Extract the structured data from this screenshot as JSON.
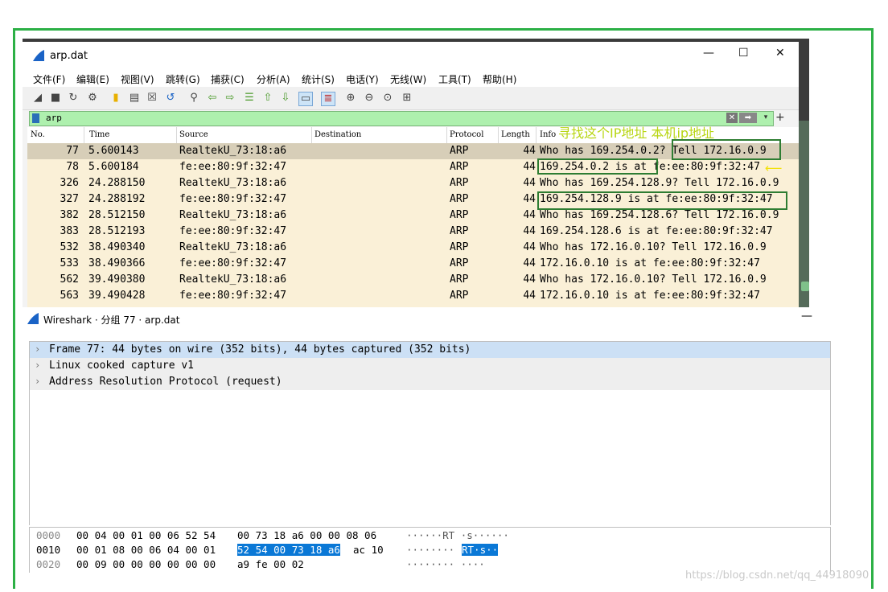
{
  "window1": {
    "title": "arp.dat",
    "controls": {
      "minimize": "—",
      "maximize": "☐",
      "close": "✕"
    },
    "menu": [
      "文件(F)",
      "编辑(E)",
      "视图(V)",
      "跳转(G)",
      "捕获(C)",
      "分析(A)",
      "统计(S)",
      "电话(Y)",
      "无线(W)",
      "工具(T)",
      "帮助(H)"
    ],
    "filter": {
      "value": "arp"
    },
    "columns": [
      "No.",
      "Time",
      "Source",
      "Destination",
      "Protocol",
      "Length",
      "Info"
    ],
    "packets": [
      {
        "no": "77",
        "time": "5.600143",
        "source": "RealtekU_73:18:a6",
        "destination": "",
        "protocol": "ARP",
        "length": "44",
        "info": "Who has 169.254.0.2? Tell 172.16.0.9"
      },
      {
        "no": "78",
        "time": "5.600184",
        "source": "fe:ee:80:9f:32:47",
        "destination": "",
        "protocol": "ARP",
        "length": "44",
        "info": "169.254.0.2 is at fe:ee:80:9f:32:47"
      },
      {
        "no": "326",
        "time": "24.288150",
        "source": "RealtekU_73:18:a6",
        "destination": "",
        "protocol": "ARP",
        "length": "44",
        "info": "Who has 169.254.128.9? Tell 172.16.0.9"
      },
      {
        "no": "327",
        "time": "24.288192",
        "source": "fe:ee:80:9f:32:47",
        "destination": "",
        "protocol": "ARP",
        "length": "44",
        "info": "169.254.128.9 is at fe:ee:80:9f:32:47"
      },
      {
        "no": "382",
        "time": "28.512150",
        "source": "RealtekU_73:18:a6",
        "destination": "",
        "protocol": "ARP",
        "length": "44",
        "info": "Who has 169.254.128.6? Tell 172.16.0.9"
      },
      {
        "no": "383",
        "time": "28.512193",
        "source": "fe:ee:80:9f:32:47",
        "destination": "",
        "protocol": "ARP",
        "length": "44",
        "info": "169.254.128.6 is at fe:ee:80:9f:32:47"
      },
      {
        "no": "532",
        "time": "38.490340",
        "source": "RealtekU_73:18:a6",
        "destination": "",
        "protocol": "ARP",
        "length": "44",
        "info": "Who has 172.16.0.10? Tell 172.16.0.9"
      },
      {
        "no": "533",
        "time": "38.490366",
        "source": "fe:ee:80:9f:32:47",
        "destination": "",
        "protocol": "ARP",
        "length": "44",
        "info": "172.16.0.10 is at fe:ee:80:9f:32:47"
      },
      {
        "no": "562",
        "time": "39.490380",
        "source": "RealtekU_73:18:a6",
        "destination": "",
        "protocol": "ARP",
        "length": "44",
        "info": "Who has 172.16.0.10? Tell 172.16.0.9"
      },
      {
        "no": "563",
        "time": "39.490428",
        "source": "fe:ee:80:9f:32:47",
        "destination": "",
        "protocol": "ARP",
        "length": "44",
        "info": "172.16.0.10 is at fe:ee:80:9f:32:47"
      }
    ]
  },
  "annotations": {
    "text": "寻找这个IP地址  本机ip地址",
    "arrow": "⟵"
  },
  "window2": {
    "title": "Wireshark · 分组 77 · arp.dat",
    "minimize": "—",
    "tree": [
      "Frame 77: 44 bytes on wire (352 bits), 44 bytes captured (352 bits)",
      "Linux cooked capture v1",
      "Address Resolution Protocol (request)"
    ],
    "hex": [
      {
        "offset": "0000",
        "b1": "00 04 00 01 00 06 52 54",
        "b2": "00 73 18 a6 00 00 08 06",
        "b3": "",
        "a1": "······RT ·s······",
        "a2": ""
      },
      {
        "offset": "0010",
        "b1": "00 01 08 00 06 04 00 01",
        "b2": "52 54 00 73 18 a6",
        "b3": "ac 10",
        "a1": "········",
        "a2": "RT·s··"
      },
      {
        "offset": "0020",
        "b1": "00 09 00 00 00 00 00 00",
        "b2": "a9 fe 00 02",
        "b3": "",
        "a1": "········ ····",
        "a2": ""
      }
    ]
  },
  "watermark": "https://blog.csdn.net/qq_44918090",
  "colors": {
    "frame": "#2cb045",
    "list_bg": "#faf0d7",
    "selected_row": "#d7ceb8",
    "filter_bg": "#aef0ae",
    "tree_selected": "#cce0f5",
    "hex_highlight": "#0a78d6"
  }
}
